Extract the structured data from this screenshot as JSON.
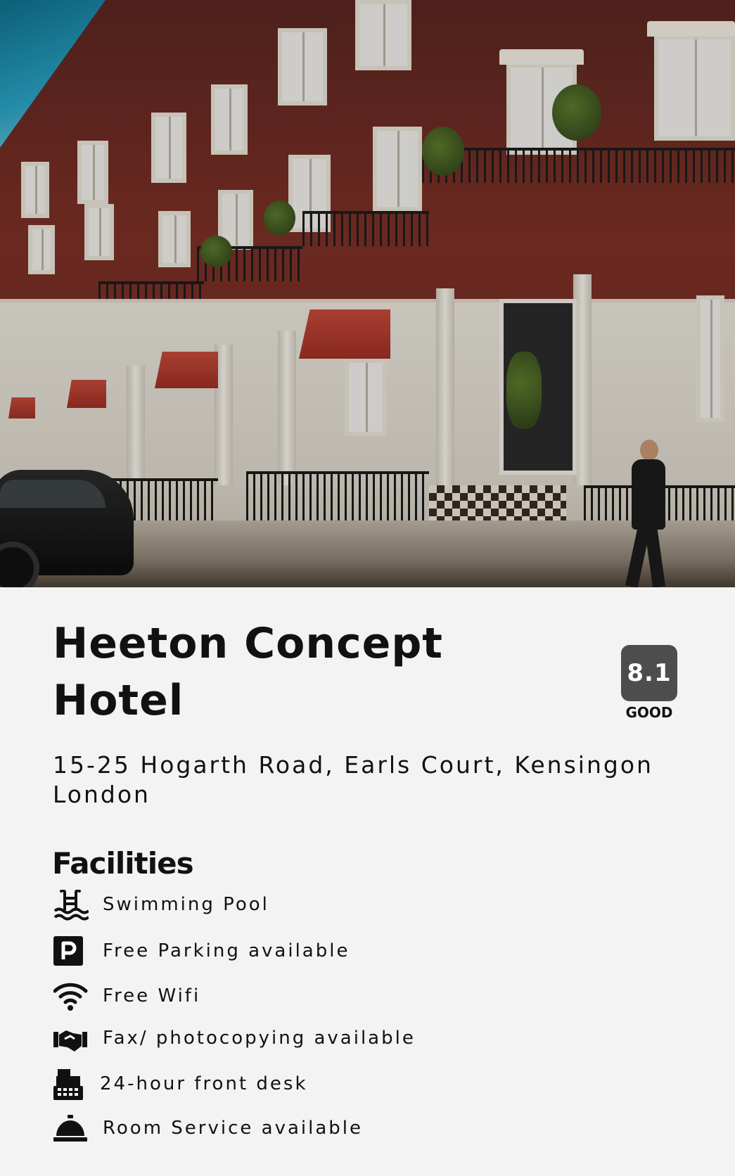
{
  "hotel": {
    "name": "Heeton Concept Hotel",
    "address": "15-25 Hogarth Road, Earls Court, Kensingon London",
    "rating": {
      "score": "8.1",
      "label": "GOOD"
    }
  },
  "facilities": {
    "title": "Facilities",
    "items": [
      {
        "icon": "swimming-pool-icon",
        "label": "Swimming Pool"
      },
      {
        "icon": "parking-icon",
        "label": "Free Parking available"
      },
      {
        "icon": "wifi-icon",
        "label": "Free Wifi"
      },
      {
        "icon": "fax-handshake-icon",
        "label": "Fax/ photocopying available"
      },
      {
        "icon": "cash-register-icon",
        "label": "24-hour front desk"
      },
      {
        "icon": "service-bell-icon",
        "label": "Room Service available"
      }
    ]
  },
  "colors": {
    "background": "#f3f3f3",
    "rating_badge": "#4d4d4d",
    "text": "#111111"
  }
}
